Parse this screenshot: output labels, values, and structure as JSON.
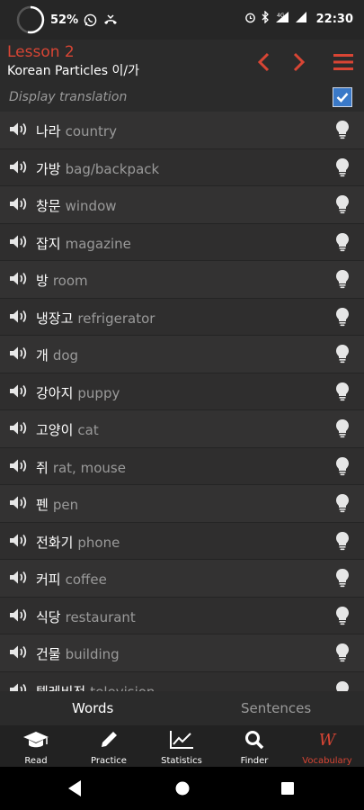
{
  "status_bar": {
    "battery_percent": "52%",
    "time": "22:30",
    "icons": [
      "battery-ring-icon",
      "whatsapp-icon",
      "missed-call-icon",
      "alarm-icon",
      "bluetooth-icon",
      "signal-4g-icon",
      "wifi-icon"
    ]
  },
  "header": {
    "title": "Lesson 2",
    "subtitle": "Korean Particles 이/가",
    "accent_color": "#d84534"
  },
  "display_translation": {
    "label": "Display translation",
    "checked": true
  },
  "words": [
    {
      "korean": "나라",
      "english": "country"
    },
    {
      "korean": "가방",
      "english": "bag/backpack"
    },
    {
      "korean": "창문",
      "english": "window"
    },
    {
      "korean": "잡지",
      "english": "magazine"
    },
    {
      "korean": "방",
      "english": "room"
    },
    {
      "korean": "냉장고",
      "english": "refrigerator"
    },
    {
      "korean": "개",
      "english": "dog"
    },
    {
      "korean": "강아지",
      "english": "puppy"
    },
    {
      "korean": "고양이",
      "english": "cat"
    },
    {
      "korean": "쥐",
      "english": "rat, mouse"
    },
    {
      "korean": "펜",
      "english": "pen"
    },
    {
      "korean": "전화기",
      "english": "phone"
    },
    {
      "korean": "커피",
      "english": "coffee"
    },
    {
      "korean": "식당",
      "english": "restaurant"
    },
    {
      "korean": "건물",
      "english": "building"
    },
    {
      "korean": "텔레비전",
      "english": "television"
    }
  ],
  "tabs": {
    "words": "Words",
    "sentences": "Sentences",
    "active": "Words"
  },
  "bottom_nav": [
    {
      "label": "Read",
      "icon": "graduation-cap-icon"
    },
    {
      "label": "Practice",
      "icon": "pencil-icon"
    },
    {
      "label": "Statistics",
      "icon": "chart-icon"
    },
    {
      "label": "Finder",
      "icon": "search-icon"
    },
    {
      "label": "Vocabulary",
      "icon": "W",
      "active": true
    }
  ]
}
